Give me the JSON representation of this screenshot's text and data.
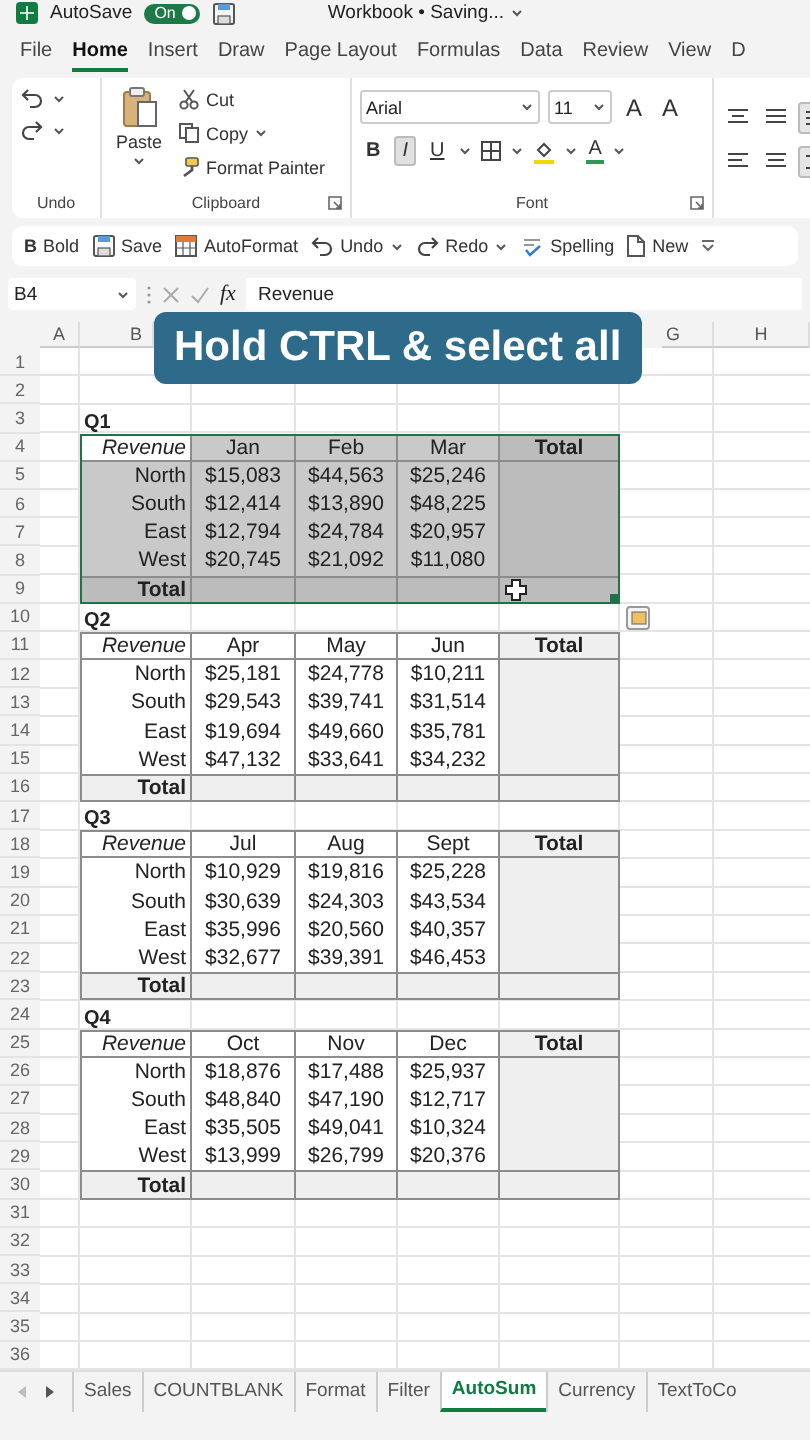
{
  "title_bar": {
    "autosave_label": "AutoSave",
    "autosave_toggle": {
      "label": "On",
      "on": true
    },
    "document_title": "Workbook • Saving..."
  },
  "menu_tabs": [
    {
      "label": "File",
      "selected": false
    },
    {
      "label": "Home",
      "selected": true
    },
    {
      "label": "Insert",
      "selected": false
    },
    {
      "label": "Draw",
      "selected": false
    },
    {
      "label": "Page Layout",
      "selected": false
    },
    {
      "label": "Formulas",
      "selected": false
    },
    {
      "label": "Data",
      "selected": false
    },
    {
      "label": "Review",
      "selected": false
    },
    {
      "label": "View",
      "selected": false
    },
    {
      "label": "D",
      "selected": false
    }
  ],
  "ribbon": {
    "undo_group": {
      "label": "Undo"
    },
    "clipboard": {
      "label": "Clipboard",
      "paste": "Paste",
      "items": [
        "Cut",
        "Copy",
        "Format Painter"
      ]
    },
    "font": {
      "label": "Font",
      "font_name": "Arial",
      "font_size": "11",
      "size_buttons": [
        "A",
        "A"
      ],
      "style_buttons": [
        {
          "label": "B",
          "selected": false
        },
        {
          "label": "I",
          "selected": true
        },
        {
          "label": "U",
          "selected": false
        }
      ],
      "font_color_letter": "A"
    },
    "alignment": [
      {
        "selected": false
      },
      {
        "selected": false
      },
      {
        "selected": true
      },
      {
        "selected": false
      },
      {
        "selected": false
      },
      {
        "selected": true
      }
    ]
  },
  "quick_toolbar": [
    {
      "label": "Bold",
      "kind": "bold",
      "glyph": "B"
    },
    {
      "label": "Save",
      "kind": "save"
    },
    {
      "label": "AutoFormat",
      "kind": "autoformat"
    },
    {
      "label": "Undo",
      "kind": "undo"
    },
    {
      "label": "Redo",
      "kind": "redo"
    },
    {
      "label": "Spelling",
      "kind": "spelling"
    },
    {
      "label": "New",
      "kind": "new"
    }
  ],
  "formula_bar": {
    "name_box": "B4",
    "function_label": "fx",
    "value": "Revenue"
  },
  "overlay_banner": "Hold CTRL & select all",
  "column_headers": [
    "A",
    "B",
    "G",
    "H"
  ],
  "row_numbers": [
    "1",
    "2",
    "3",
    "4",
    "5",
    "6",
    "7",
    "8",
    "9",
    "10",
    "11",
    "12",
    "13",
    "14",
    "15",
    "16",
    "17",
    "18",
    "19",
    "20",
    "21",
    "22",
    "23",
    "24",
    "25",
    "26",
    "27",
    "28",
    "29",
    "30",
    "31",
    "32",
    "33",
    "34",
    "35",
    "36"
  ],
  "quarters": [
    {
      "title": "Q1",
      "selected": true,
      "header": [
        "Revenue",
        "Jan",
        "Feb",
        "Mar",
        "Total"
      ],
      "total_label": "Total",
      "rows": [
        {
          "region": "North",
          "values": [
            "$15,083",
            "$44,563",
            "$25,246"
          ]
        },
        {
          "region": "South",
          "values": [
            "$12,414",
            "$13,890",
            "$48,225"
          ]
        },
        {
          "region": "East",
          "values": [
            "$12,794",
            "$24,784",
            "$20,957"
          ]
        },
        {
          "region": "West",
          "values": [
            "$20,745",
            "$21,092",
            "$11,080"
          ]
        }
      ]
    },
    {
      "title": "Q2",
      "selected": false,
      "header": [
        "Revenue",
        "Apr",
        "May",
        "Jun",
        "Total"
      ],
      "total_label": "Total",
      "rows": [
        {
          "region": "North",
          "values": [
            "$25,181",
            "$24,778",
            "$10,211"
          ]
        },
        {
          "region": "South",
          "values": [
            "$29,543",
            "$39,741",
            "$31,514"
          ]
        },
        {
          "region": "East",
          "values": [
            "$19,694",
            "$49,660",
            "$35,781"
          ]
        },
        {
          "region": "West",
          "values": [
            "$47,132",
            "$33,641",
            "$34,232"
          ]
        }
      ]
    },
    {
      "title": "Q3",
      "selected": false,
      "header": [
        "Revenue",
        "Jul",
        "Aug",
        "Sept",
        "Total"
      ],
      "total_label": "Total",
      "rows": [
        {
          "region": "North",
          "values": [
            "$10,929",
            "$19,816",
            "$25,228"
          ]
        },
        {
          "region": "South",
          "values": [
            "$30,639",
            "$24,303",
            "$43,534"
          ]
        },
        {
          "region": "East",
          "values": [
            "$35,996",
            "$20,560",
            "$40,357"
          ]
        },
        {
          "region": "West",
          "values": [
            "$32,677",
            "$39,391",
            "$46,453"
          ]
        }
      ]
    },
    {
      "title": "Q4",
      "selected": false,
      "header": [
        "Revenue",
        "Oct",
        "Nov",
        "Dec",
        "Total"
      ],
      "total_label": "Total",
      "rows": [
        {
          "region": "North",
          "values": [
            "$18,876",
            "$17,488",
            "$25,937"
          ]
        },
        {
          "region": "South",
          "values": [
            "$48,840",
            "$47,190",
            "$12,717"
          ]
        },
        {
          "region": "East",
          "values": [
            "$35,505",
            "$49,041",
            "$10,324"
          ]
        },
        {
          "region": "West",
          "values": [
            "$13,999",
            "$26,799",
            "$20,376"
          ]
        }
      ]
    }
  ],
  "sheet_tabs": [
    {
      "label": "Sales",
      "selected": false
    },
    {
      "label": "COUNTBLANK",
      "selected": false
    },
    {
      "label": "Format",
      "selected": false
    },
    {
      "label": "Filter",
      "selected": false
    },
    {
      "label": "AutoSum",
      "selected": true
    },
    {
      "label": "Currency",
      "selected": false
    },
    {
      "label": "TextToCo",
      "selected": false
    }
  ]
}
